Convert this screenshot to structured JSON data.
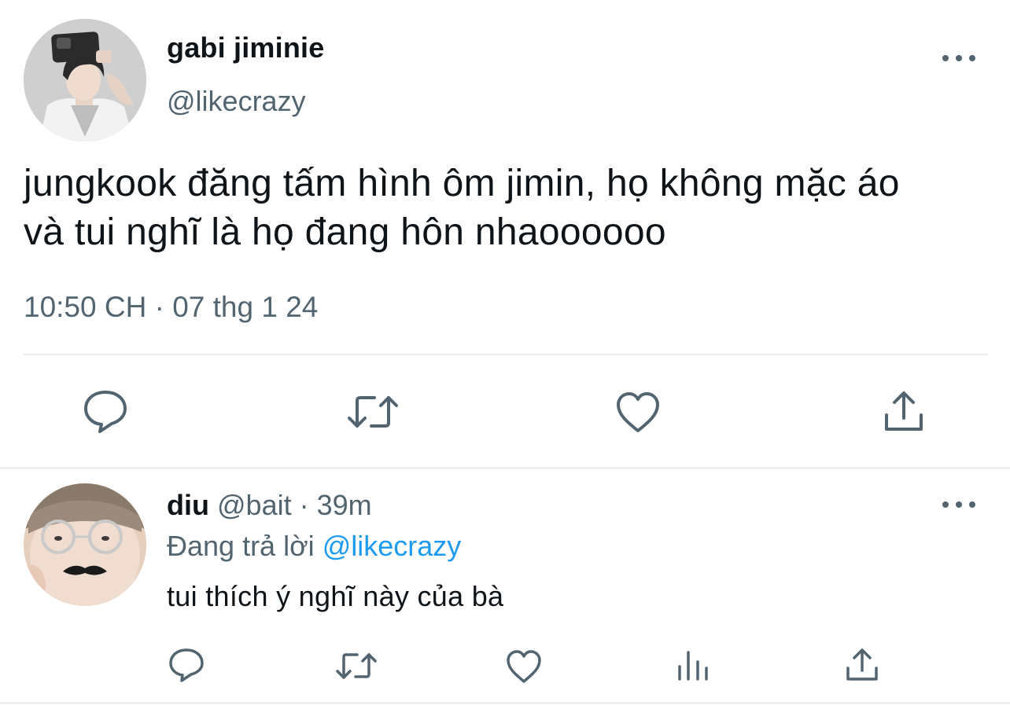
{
  "tweet": {
    "display_name": "gabi jiminie",
    "handle": "@likecrazy",
    "text_line1": "jungkook đăng tấm hình ôm jimin, họ không mặc áo",
    "text_line2": "và tui nghĩ là họ đang hôn nhaoooooo",
    "timestamp": "10:50 CH · 07 thg 1 24",
    "actions": [
      "reply-icon",
      "retweet-icon",
      "like-icon",
      "share-icon"
    ]
  },
  "reply": {
    "display_name": "diu",
    "handle": "@bait",
    "separator": "·",
    "time": "39m",
    "replying_prefix": "Đang trả lời",
    "replying_to": "@likecrazy",
    "text": "tui thích ý nghĩ này của bà",
    "actions": [
      "reply-icon",
      "retweet-icon",
      "like-icon",
      "views-icon",
      "share-icon"
    ]
  },
  "colors": {
    "text_primary": "#0f1419",
    "text_secondary": "#536471",
    "link": "#1d9bf0",
    "divider": "#e9ecef"
  }
}
